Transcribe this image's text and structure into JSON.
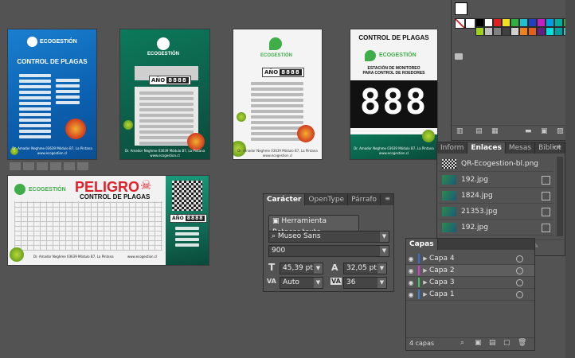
{
  "artboards": {
    "a1": {
      "brand": "ECOGESTIÓN",
      "title": "CONTROL DE PLAGAS",
      "footer": "Dr. Amador Neghme 03639 Módulo B7, La Pintana",
      "web": "www.ecogestion.cl"
    },
    "a2": {
      "brand": "ECOGESTIÓN",
      "year_label": "AÑO",
      "year_digits": "8888",
      "footer": "Dr. Amador Neghme 03639 Módulo B7, La Pintana",
      "web": "www.ecogestion.cl"
    },
    "a3": {
      "brand": "ECOGESTIÓN",
      "year_label": "AÑO",
      "year_digits": "8888",
      "footer": "Dr. Amador Neghme 03639 Módulo B7, La Pintana",
      "web": "www.ecogestion.cl"
    },
    "a4": {
      "title": "CONTROL DE PLAGAS",
      "brand": "ECOGESTIÓN",
      "subtitle": "ESTACIÓN DE MONITOREO PARA CONTROL DE ROEDORES",
      "digits": "888",
      "footer": "Dr. Amador Neghme 03639 Módulo B7, La Pintana",
      "web": "www.ecogestion.cl"
    },
    "a5": {
      "brand": "ECOGESTIÓN",
      "title": "PELIGRO",
      "subtitle": "CONTROL DE PLAGAS",
      "year_label": "AÑO",
      "year_digits": "8888",
      "footer_left": "Dr. Amador Neghme 03639 Módulo B7, La Pintana",
      "footer_right": "www.ecogestion.cl"
    }
  },
  "character_panel": {
    "tabs": [
      "Carácter",
      "OpenType",
      "Párrafo"
    ],
    "touch_button": "Herramienta Retocar texto",
    "font_family": "Museo Sans",
    "font_style": "900",
    "font_size": "45,39 pt",
    "leading": "32,05 pt",
    "kerning": "Auto",
    "tracking": "36",
    "icon_size": "T",
    "icon_leading": "A",
    "icon_kerning": "VA",
    "icon_tracking": "VA"
  },
  "links_panel": {
    "tabs": [
      "Inform",
      "Enlaces",
      "Mesas",
      "Bibliot"
    ],
    "items": [
      "QR-Ecogestion-bl.png",
      "192.jpg",
      "1824.jpg",
      "21353.jpg",
      "192.jpg"
    ]
  },
  "layers_panel": {
    "tab": "Capas",
    "layers": [
      {
        "name": "Capa 4",
        "color": "#3a6bd8"
      },
      {
        "name": "Capa 2",
        "color": "#d83ad0"
      },
      {
        "name": "Capa 3",
        "color": "#3ac85a"
      },
      {
        "name": "Capa 1",
        "color": "#3a7ad8"
      }
    ],
    "count": "4 capas"
  },
  "swatches": {
    "colors": [
      "#000000",
      "#ffffff",
      "#e02020",
      "#f0e020",
      "#30b040",
      "#20c0d0",
      "#2040c0",
      "#c020c0",
      "#00a0e0",
      "#00b0a0",
      "#40a040",
      "#80c040",
      "#a0d020",
      "#c0c0c0",
      "#808080",
      "#404040",
      "#d0d0d0",
      "#f08020",
      "#e06020",
      "#602080",
      "#00e0e0",
      "#00a0a0",
      "#40c0c0",
      "#20a060"
    ]
  }
}
